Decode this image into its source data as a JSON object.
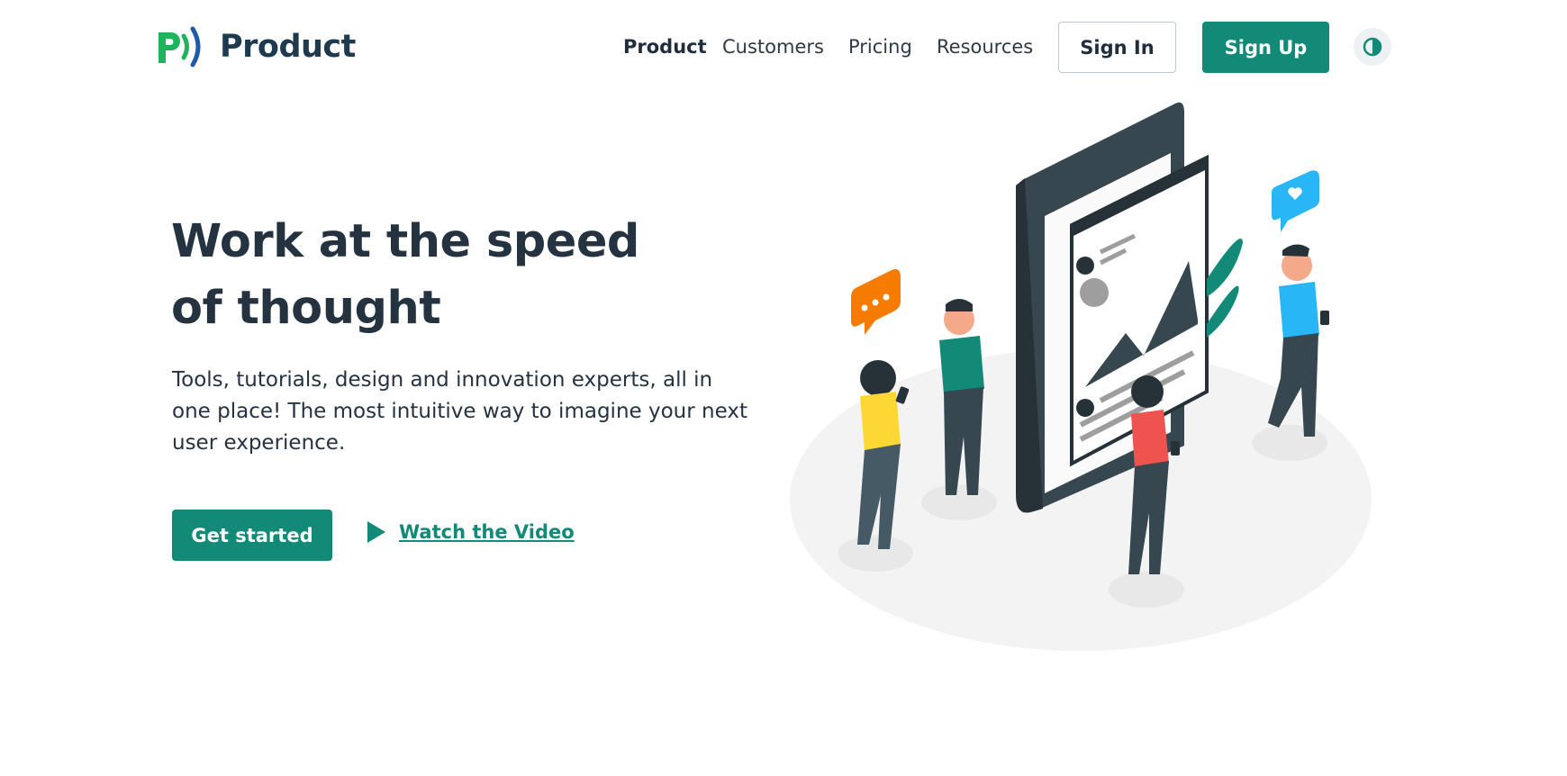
{
  "header": {
    "logo_text": "Product",
    "nav": [
      {
        "label": "Product",
        "active": true
      },
      {
        "label": "Customers",
        "active": false
      },
      {
        "label": "Pricing",
        "active": false
      },
      {
        "label": "Resources",
        "active": false
      }
    ],
    "sign_in": "Sign In",
    "sign_up": "Sign Up",
    "theme_icon": "contrast-icon"
  },
  "hero": {
    "title_line1": "Work at the speed",
    "title_line2": "of thought",
    "subtitle": "Tools, tutorials, design and innovation experts, all in one place! The most intuitive way to imagine your next user experience.",
    "cta_primary": "Get started",
    "cta_secondary": "Watch the Video"
  },
  "colors": {
    "brand": "#138a78",
    "heading": "#253341",
    "logo_green": "#1fb35c",
    "logo_blue": "#1e5aa8"
  }
}
